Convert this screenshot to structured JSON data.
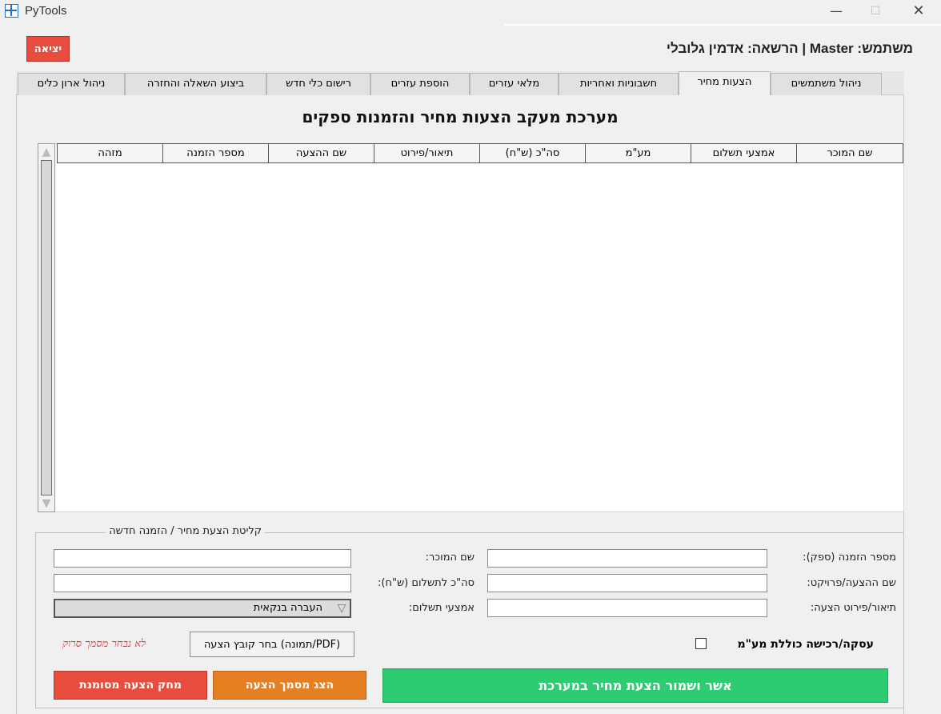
{
  "window": {
    "title": "PyTools",
    "app_icon": "grid-window-icon",
    "minimize_glyph": "—",
    "maximize_glyph": "☐",
    "close_glyph": "✕"
  },
  "header": {
    "exit_label": "יציאה",
    "user_line": "הרשאה: אדמין גלובלי | Master :משתמש"
  },
  "tabs": [
    {
      "label": "ניהול משתמשים",
      "active": false
    },
    {
      "label": "הצעות מחיר",
      "active": true
    },
    {
      "label": "חשבוניות ואחריות",
      "active": false
    },
    {
      "label": "מלאי עזרים",
      "active": false
    },
    {
      "label": "הוספת עזרים",
      "active": false
    },
    {
      "label": "רישום כלי חדש",
      "active": false
    },
    {
      "label": "ביצוע השאלה והחזרה",
      "active": false
    },
    {
      "label": "ניהול ארון כלים",
      "active": false
    }
  ],
  "main": {
    "title": "מערכת מעקב הצעות מחיר והזמנות ספקים"
  },
  "table": {
    "columns": [
      "שם המוכר",
      "אמצעי תשלום",
      "מע\"מ",
      "סה\"כ (ש\"ח)",
      "תיאור/פירוט",
      "שם ההצעה",
      "מספר הזמנה",
      "מזהה"
    ],
    "rows": []
  },
  "form": {
    "legend": "קליטת הצעת מחיר / הזמנה חדשה",
    "order_number_label": ":מספר הזמנה (ספק)",
    "order_number_value": "",
    "quote_name_label": ":שם ההצעה/פרויקט",
    "quote_name_value": "",
    "description_label": ":תיאור/פירוט הצעה",
    "description_value": "",
    "seller_label": ":שם המוכר",
    "seller_value": "",
    "total_label": ":סה\"כ לתשלום (ש\"ח)",
    "total_value": "",
    "payment_label": ":אמצעי תשלום",
    "payment_selected": "העברה בנקאית",
    "vat_checkbox_label": "עסקה/רכישה כוללת מע\"מ",
    "vat_checked": false,
    "file_button_label": "(PDF/תמונה) בחר קובץ הצעה",
    "no_file_text": "לא נבחר מסמך סרוק",
    "save_button": "אשר ושמור הצעת מחיר במערכת",
    "show_doc_button": "הצג מסמך הצעה",
    "delete_button": "מחק הצעה מסומנת"
  },
  "colors": {
    "exit": "#e74c3c",
    "save": "#2ecc71",
    "show": "#e67e22",
    "delete": "#e74c3c",
    "warning_text": "#e53935"
  }
}
